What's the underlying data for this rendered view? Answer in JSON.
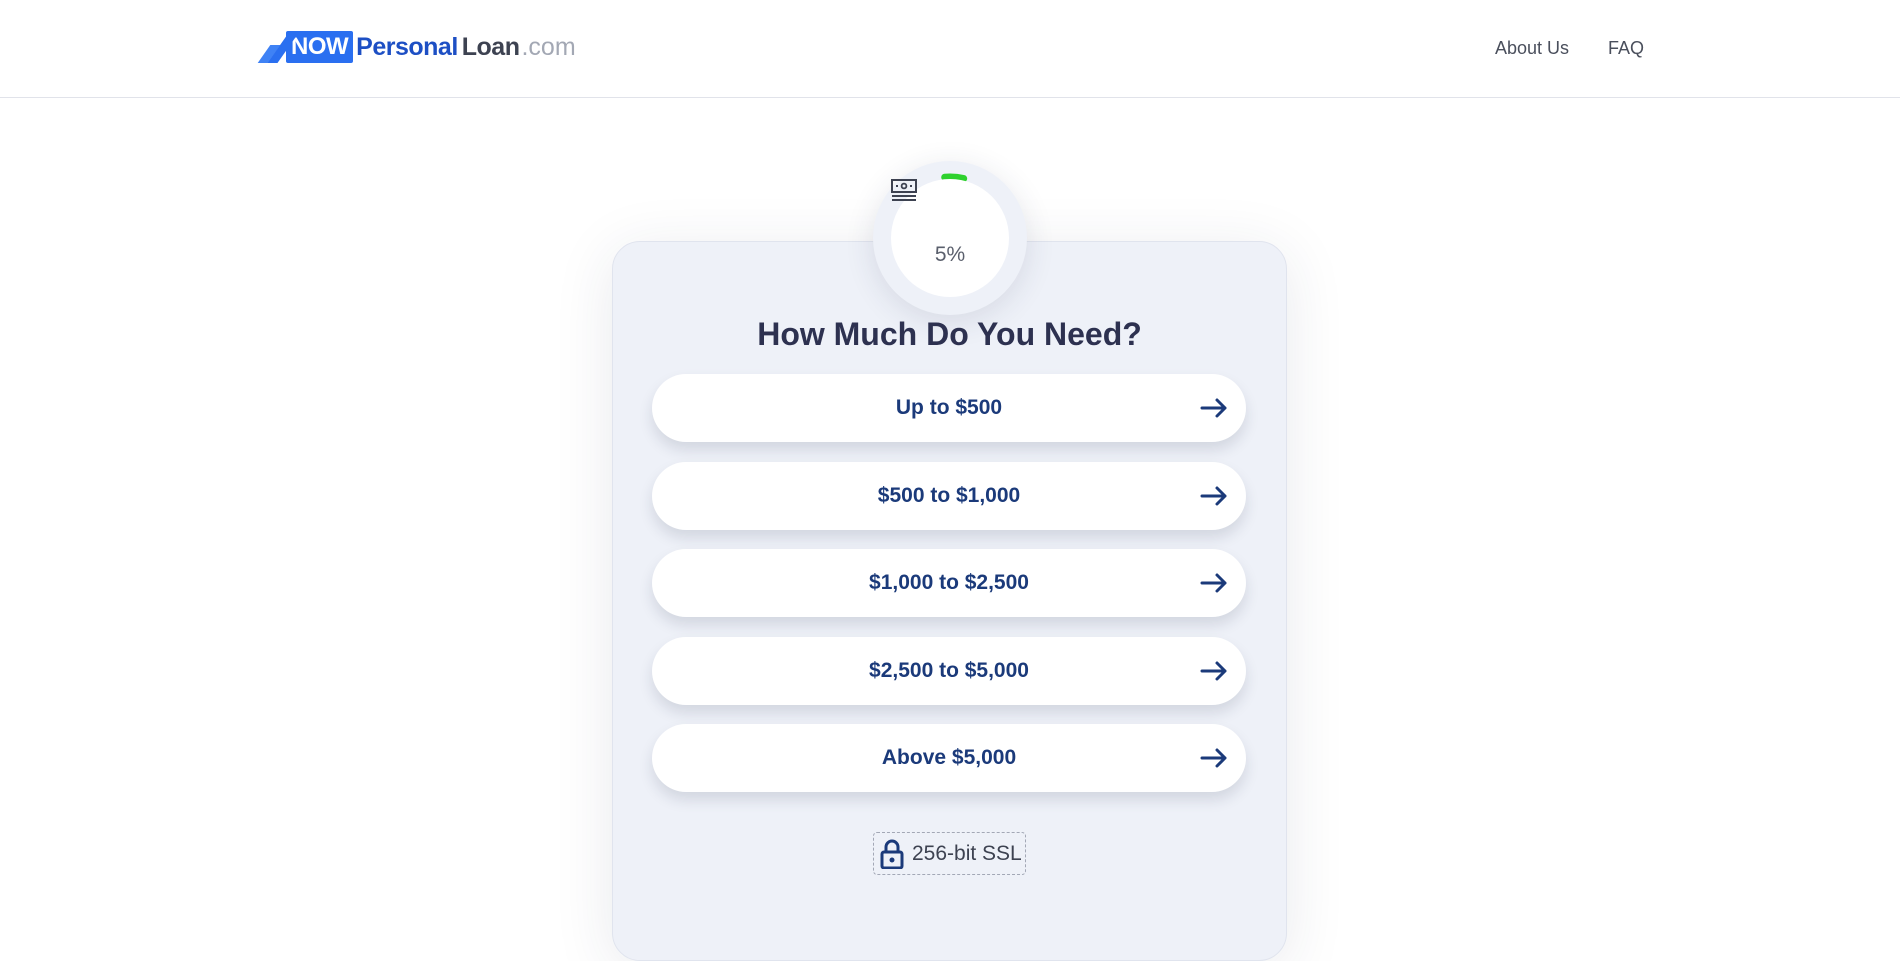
{
  "header": {
    "logo": {
      "now": "NOW",
      "personal": "Personal",
      "loan": "Loan",
      "dotcom": ".com"
    },
    "nav": [
      {
        "label": "About Us"
      },
      {
        "label": "FAQ"
      }
    ]
  },
  "progress": {
    "value_percent": 5,
    "label": "5%",
    "icon": "money-icon",
    "ring_color": "#2ed12e"
  },
  "question": {
    "title": "How Much Do You Need?"
  },
  "options": [
    {
      "label": "Up to $500"
    },
    {
      "label": "$500 to $1,000"
    },
    {
      "label": "$1,000 to $2,500"
    },
    {
      "label": "$2,500 to $5,000"
    },
    {
      "label": "Above $5,000"
    }
  ],
  "security": {
    "label": "256-bit SSL",
    "icon": "lock-icon"
  },
  "colors": {
    "brand": "#2a6ff0",
    "option_text": "#1b3a7a",
    "heading": "#2d3150"
  }
}
